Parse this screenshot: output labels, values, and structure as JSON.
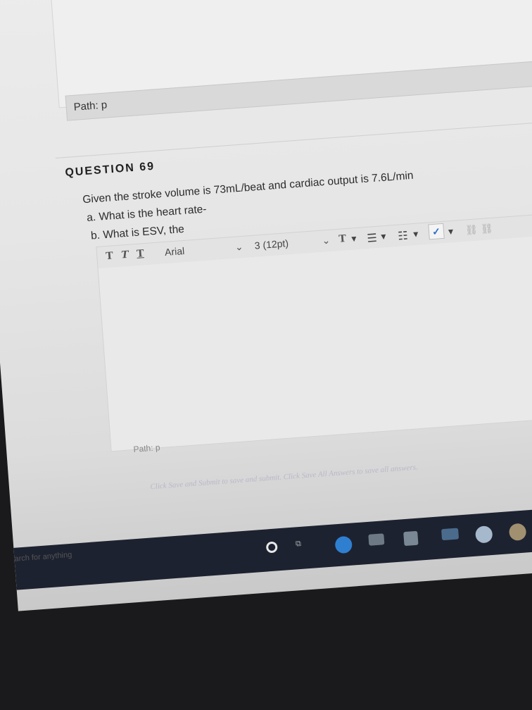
{
  "previous": {
    "path_label": "Path: p"
  },
  "question": {
    "title": "QUESTION 69",
    "prompt": "Given the stroke volume is 73mL/beat and cardiac output is 7.6L/min",
    "part_a": "a. What is the heart rate-",
    "part_b": "b. What is ESV, the"
  },
  "toolbar": {
    "font_family": "Arial",
    "font_size": "3 (12pt)",
    "text_style_1": "T",
    "text_style_2": "T",
    "text_style_3": "T",
    "text_color_label": "T"
  },
  "editor": {
    "value": "",
    "path_label": "Path: p"
  },
  "footer": {
    "text": "Click Save and Submit to save and submit. Click Save All Answers to save all answers."
  },
  "taskbar": {
    "search_hint": "arch for anything"
  },
  "colors": {
    "taskbar": "#1d2230",
    "edge": "#2f7fd1",
    "spell": "#2f6fc7"
  }
}
